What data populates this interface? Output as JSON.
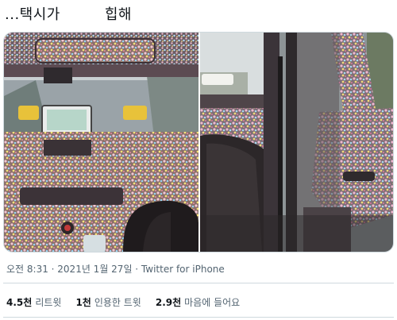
{
  "tweet": {
    "text": "...택시가         힙해"
  },
  "media": {
    "left_photo_icon": "car-interior-photo",
    "right_photo_icon": "car-door-photo"
  },
  "meta": {
    "text": "오전 8:31 · 2021년 1월 27일 · Twitter for iPhone"
  },
  "stats": [
    {
      "count": "4.5천",
      "label": "리트윗"
    },
    {
      "count": "1천",
      "label": "인용한 트윗"
    },
    {
      "count": "2.9천",
      "label": "마음에 들어요"
    }
  ]
}
